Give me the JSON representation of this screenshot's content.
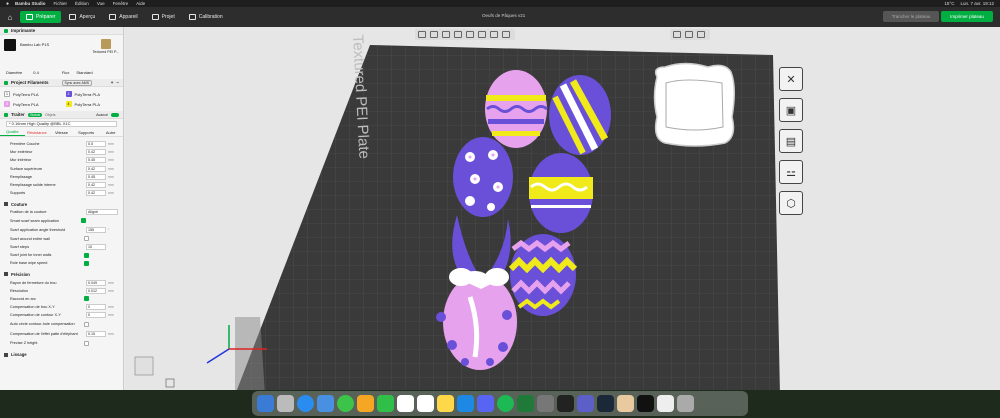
{
  "menubar": {
    "apple": "",
    "app_name": "Bambu Studio",
    "items": [
      "Fichier",
      "Édition",
      "Vue",
      "Fenêtre",
      "Aide"
    ],
    "right": [
      "15°C",
      "Lun. 7 avr. 19:12"
    ]
  },
  "toolbar": {
    "tabs": [
      "Préparer",
      "Aperçu",
      "Appareil",
      "Projet",
      "Calibration"
    ],
    "active_tab": "Préparer",
    "doc_title": "Oeufs de Pâques v21",
    "slice_label": "Trancher le plateau",
    "print_label": "Imprimer plateau"
  },
  "printer": {
    "section": "Imprimante",
    "model": "Bambu Lab P1S",
    "plate": "Textured PEI P...",
    "diameter_label": "Diamètre",
    "diameter_value": "0.4",
    "flux_label": "Flux",
    "flux_value": "Standard"
  },
  "filaments": {
    "section": "Project Filaments",
    "sync_label": "Sync avec AMS",
    "items": [
      {
        "num": "1",
        "name": "PolyTerra PLA",
        "color": "#ffffff"
      },
      {
        "num": "2",
        "name": "PolyTerra PLA",
        "color": "#6a50d8"
      },
      {
        "num": "3",
        "name": "PolyTerra PLA",
        "color": "#e59fe8"
      },
      {
        "num": "4",
        "name": "PolyTerra PLA",
        "color": "#f0ea1a"
      }
    ]
  },
  "process": {
    "section": "Traiter",
    "global_label": "Global",
    "objects_label": "Objets",
    "advanced_label": "Avancé",
    "preset": "* 0.16mm High Quality @BBL X1C",
    "tabs": [
      "Qualité",
      "Résistance",
      "Vitesse",
      "Supports",
      "Autre"
    ],
    "walls": [
      {
        "label": "Première Couche",
        "value": "0.5",
        "unit": "mm"
      },
      {
        "label": "Mur extérieur",
        "value": "0.42",
        "unit": "mm"
      },
      {
        "label": "Mur intérieur",
        "value": "0.45",
        "unit": "mm"
      },
      {
        "label": "Surface supérieure",
        "value": "0.42",
        "unit": "mm"
      },
      {
        "label": "Remplissage",
        "value": "0.45",
        "unit": "mm"
      },
      {
        "label": "Remplissage solide interne",
        "value": "0.42",
        "unit": "mm"
      },
      {
        "label": "Supports",
        "value": "0.42",
        "unit": "mm"
      }
    ],
    "seam_group": "Couture",
    "seam": [
      {
        "label": "Position de la couture",
        "value": "Aligné",
        "type": "select"
      },
      {
        "label": "Smart scarf seam application",
        "type": "check",
        "on": true
      },
      {
        "label": "Scarf application angle threshold",
        "value": "155",
        "unit": "°",
        "type": "num"
      },
      {
        "label": "Scarf around entire wall",
        "type": "check",
        "on": false
      },
      {
        "label": "Scarf steps",
        "value": "10",
        "type": "num"
      },
      {
        "label": "Scarf joint for inner walls",
        "type": "check",
        "on": true
      },
      {
        "label": "Role base wipe speed",
        "type": "check",
        "on": true
      }
    ],
    "precision_group": "Précision",
    "precision": [
      {
        "label": "Rayon de fermeture du trou",
        "value": "0.049",
        "unit": "mm",
        "type": "num"
      },
      {
        "label": "Résolution",
        "value": "0.012",
        "unit": "mm",
        "type": "num"
      },
      {
        "label": "Raccord en arc",
        "type": "check",
        "on": true
      },
      {
        "label": "Compensation de trou X-Y",
        "value": "0",
        "unit": "mm",
        "type": "num"
      },
      {
        "label": "Compensation de contour X-Y",
        "value": "0",
        "unit": "mm",
        "type": "num"
      },
      {
        "label": "Auto circle contour-hole compensation",
        "type": "check",
        "on": false
      },
      {
        "label": "Compensation de l'effet patte d'éléphant",
        "value": "0.15",
        "unit": "mm",
        "type": "num"
      },
      {
        "label": "Precise Z height",
        "type": "check",
        "on": false
      }
    ],
    "layers_group": "Lissage"
  },
  "plate": {
    "label": "Textured PEI Plate",
    "color": "#3a3a3a",
    "eggs": [
      {
        "body": "#e6a2ec",
        "accent": "#6a50d8",
        "stripe": "#f0ea1a"
      },
      {
        "body": "#6a50d8",
        "accent": "#ffffff",
        "stripe": "#f0ea1a"
      },
      {
        "body": "#6a50d8",
        "accent": "#ffffff",
        "stripe": "#e6a2ec"
      },
      {
        "body": "#6a50d8",
        "accent": "#ffffff",
        "stripe": "#f0ea1a"
      },
      {
        "body": "#6a50d8",
        "accent": "#e6a2ec",
        "stripe": "#f0ea1a"
      },
      {
        "body": "#e6a2ec",
        "accent": "#6a50d8",
        "stripe": "#ffffff"
      }
    ]
  }
}
